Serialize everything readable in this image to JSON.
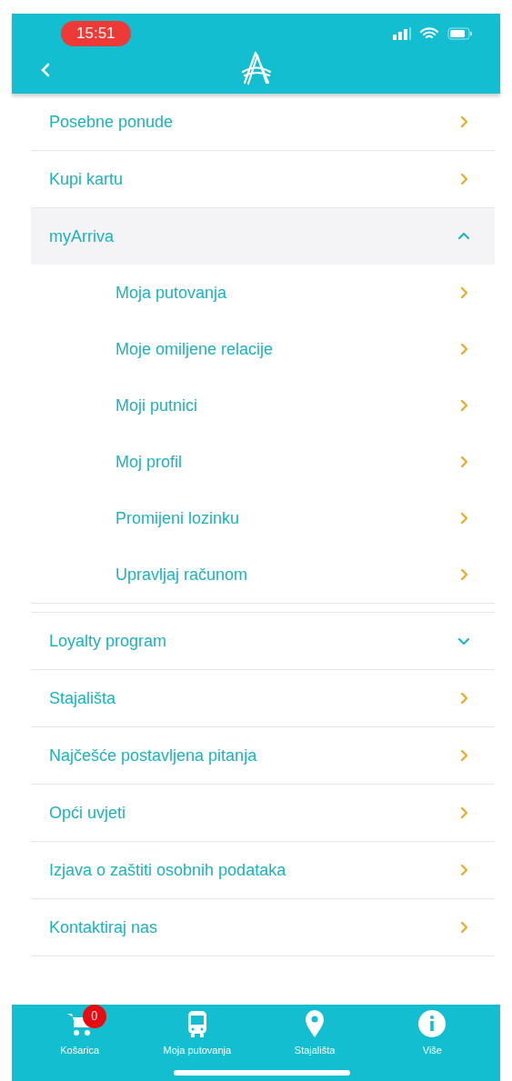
{
  "status_bar": {
    "time": "15:51"
  },
  "menu": [
    {
      "kind": "link",
      "label": "Posebne ponude"
    },
    {
      "kind": "link",
      "label": "Kupi kartu"
    },
    {
      "kind": "group",
      "label": "myArriva",
      "expanded": true,
      "children": [
        {
          "label": "Moja putovanja"
        },
        {
          "label": "Moje omiljene relacije"
        },
        {
          "label": "Moji putnici"
        },
        {
          "label": "Moj profil"
        },
        {
          "label": "Promijeni lozinku"
        },
        {
          "label": "Upravljaj računom"
        }
      ]
    },
    {
      "kind": "group",
      "label": "Loyalty program",
      "expanded": false
    },
    {
      "kind": "link",
      "label": "Stajališta"
    },
    {
      "kind": "link",
      "label": "Najčešće postavljena pitanja"
    },
    {
      "kind": "link",
      "label": "Opći uvjeti"
    },
    {
      "kind": "link",
      "label": "Izjava o zaštiti osobnih podataka"
    },
    {
      "kind": "link",
      "label": "Kontaktiraj nas"
    }
  ],
  "tab_bar": [
    {
      "kind": "cart",
      "label": "Košarica",
      "badge": "0"
    },
    {
      "kind": "bus",
      "label": "Moja putovanja"
    },
    {
      "kind": "pin",
      "label": "Stajališta"
    },
    {
      "kind": "info",
      "label": "Više"
    }
  ]
}
